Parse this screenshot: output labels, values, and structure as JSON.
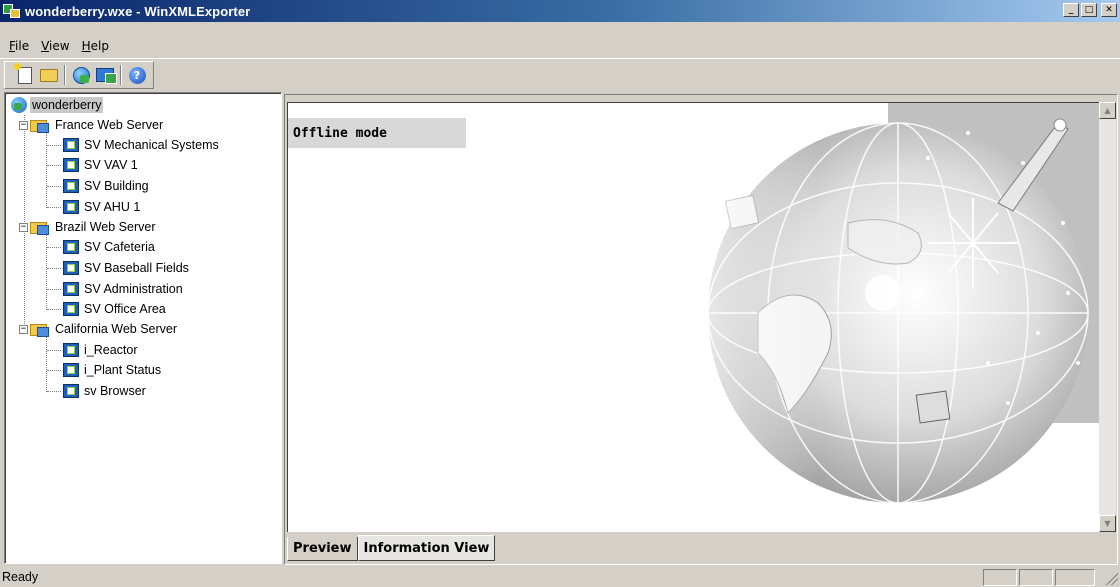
{
  "window": {
    "title": "wonderberry.wxe - WinXMLExporter",
    "controls": {
      "minimize": "_",
      "maximize": "□",
      "close": "✕"
    }
  },
  "menu": [
    {
      "label": "File",
      "accel": "F",
      "rest": "ile"
    },
    {
      "label": "View",
      "accel": "V",
      "rest": "iew"
    },
    {
      "label": "Help",
      "accel": "H",
      "rest": "elp"
    }
  ],
  "toolbar": {
    "buttons": [
      "new-icon",
      "open-folder-icon",
      "globe-icon",
      "export-icon",
      "help-icon"
    ],
    "help_glyph": "?"
  },
  "tree": {
    "root": "wonderberry",
    "servers": [
      {
        "name": "France Web Server",
        "children": [
          "SV Mechanical Systems",
          "SV VAV 1",
          "SV Building",
          "SV AHU 1"
        ]
      },
      {
        "name": "Brazil Web Server",
        "children": [
          "SV Cafeteria",
          "SV Baseball Fields",
          "SV Administration",
          "SV Office Area"
        ]
      },
      {
        "name": "California Web Server",
        "children": [
          "i_Reactor",
          "i_Plant Status",
          "sv Browser"
        ]
      }
    ],
    "expander_glyph": "−"
  },
  "content": {
    "mode_label": "Offline mode"
  },
  "tabs": [
    {
      "label": "Preview",
      "active": false
    },
    {
      "label": "Information View",
      "active": true
    }
  ],
  "scroll": {
    "up": "▲",
    "down": "▼"
  },
  "status": {
    "text": "Ready"
  }
}
